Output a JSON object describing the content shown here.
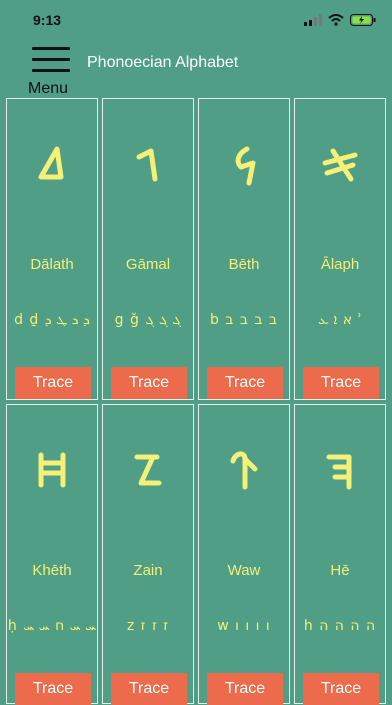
{
  "status": {
    "time": "9:13"
  },
  "header": {
    "menu_label": "Menu",
    "title": "Phonoecian Alphabet"
  },
  "letters": [
    {
      "name": "Dālath",
      "translit": "d ḏ ܕ ܖ ܛ ܕ",
      "glyph": "dalath-glyph",
      "trace": "Trace"
    },
    {
      "name": "Gāmal",
      "translit": "g ǧ ܓ ܓ ܓ",
      "glyph": "gamal-glyph",
      "trace": "Trace"
    },
    {
      "name": "Bēth",
      "translit": "b ב ב ב ב",
      "glyph": "beth-glyph",
      "trace": "Trace"
    },
    {
      "name": "Ālaph",
      "translit": "א ܐ ܥ ʾ",
      "glyph": "alaph-glyph",
      "trace": "Trace"
    },
    {
      "name": "Khēth",
      "translit": "ḥ ܚ ܚ ח ܚ ܚ",
      "glyph": "kheth-glyph",
      "trace": "Trace"
    },
    {
      "name": "Zain",
      "translit": "z ז ז ז",
      "glyph": "zain-glyph",
      "trace": "Trace"
    },
    {
      "name": "Waw",
      "translit": "w ו ו ו ו",
      "glyph": "waw-glyph",
      "trace": "Trace"
    },
    {
      "name": "Hē",
      "translit": "h ה ה ה ה",
      "glyph": "he-glyph",
      "trace": "Trace"
    }
  ],
  "colors": {
    "background": "#4f9e85",
    "glyph": "#f4f078",
    "trace_button": "#ec6b4c"
  }
}
